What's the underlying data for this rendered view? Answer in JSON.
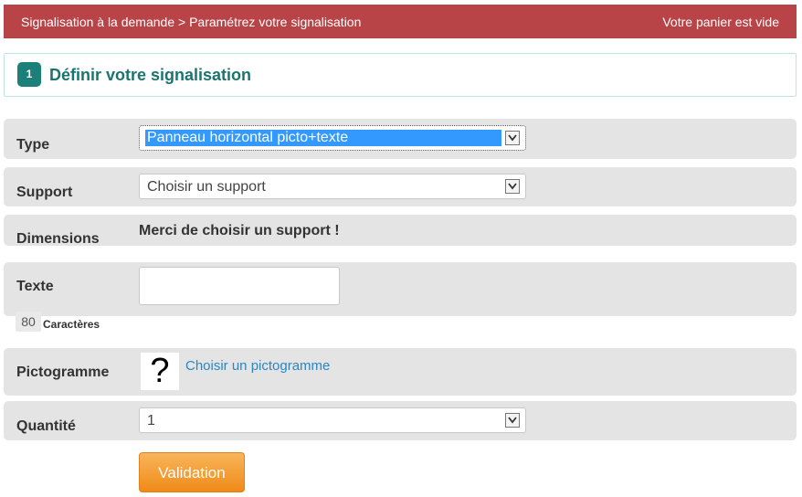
{
  "header": {
    "breadcrumb": "Signalisation à la demande > Paramétrez votre signalisation",
    "cart_status": "Votre panier est vide"
  },
  "step": {
    "number": "1",
    "title": "Définir votre signalisation"
  },
  "form": {
    "type": {
      "label": "Type",
      "value": "Panneau horizontal picto+texte"
    },
    "support": {
      "label": "Support",
      "value": "Choisir un support"
    },
    "dimensions": {
      "label": "Dimensions",
      "message": "Merci de choisir un support !"
    },
    "texte": {
      "label": "Texte",
      "value": "",
      "char_count": "80",
      "char_label": "Caractères"
    },
    "pictogramme": {
      "label": "Pictogramme",
      "placeholder_glyph": "?",
      "link": "Choisir un pictogramme"
    },
    "quantite": {
      "label": "Quantité",
      "value": "1"
    }
  },
  "actions": {
    "validate_label": "Validation"
  },
  "colors": {
    "header_bg": "#b94447",
    "step_badge": "#1a8079",
    "row_bg": "#e4e4e4",
    "link": "#2a86c4",
    "button": "#f08a18"
  }
}
